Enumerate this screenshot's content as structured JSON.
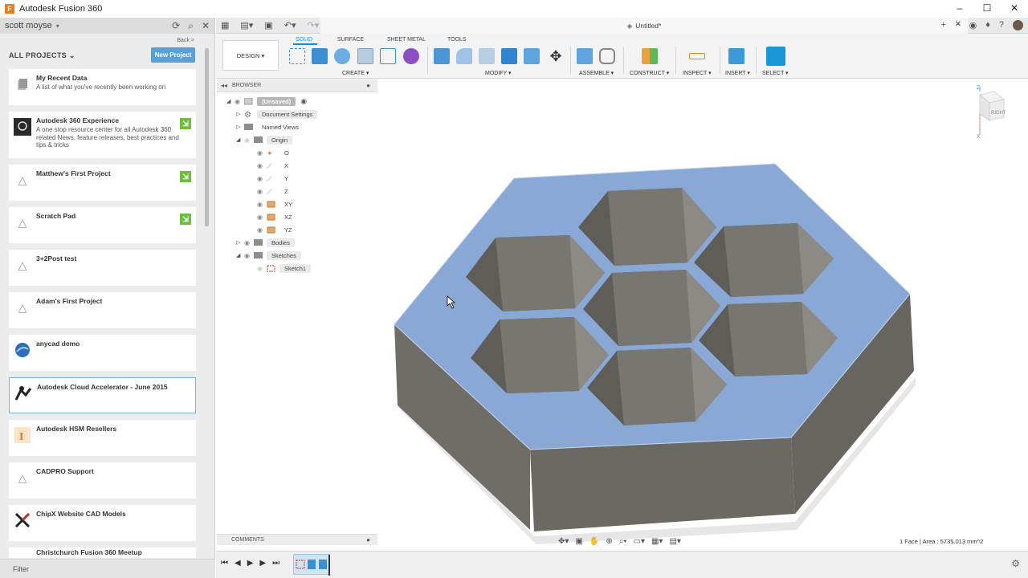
{
  "window": {
    "title": "Autodesk Fusion 360",
    "logo_letter": "F",
    "controls": [
      "–",
      "☐",
      "✕"
    ]
  },
  "data_panel": {
    "user": "scott moyse",
    "back_label": "Back >",
    "projects_heading": "ALL PROJECTS",
    "new_project_label": "New Project",
    "projects": [
      {
        "title": "My Recent Data",
        "description": "A list of what you've recently been working on",
        "icon": "file-icon",
        "badge": false,
        "selected": false
      },
      {
        "title": "Autodesk 360 Experience",
        "description": "A one stop resource center for all Autodesk 360 related News, feature releases, best practices and tips & tricks",
        "icon": "experience-logo-icon",
        "badge": true,
        "selected": false
      },
      {
        "title": "Matthew's First Project",
        "description": "",
        "icon": "project-icon",
        "badge": true,
        "selected": false
      },
      {
        "title": "Scratch Pad",
        "description": "",
        "icon": "project-icon",
        "badge": true,
        "selected": false
      },
      {
        "title": "3+2Post test",
        "description": "",
        "icon": "project-icon",
        "badge": false,
        "selected": false
      },
      {
        "title": "Adam's First Project",
        "description": "",
        "icon": "project-icon",
        "badge": false,
        "selected": false
      },
      {
        "title": "anycad demo",
        "description": "",
        "icon": "anycad-icon",
        "badge": false,
        "selected": false
      },
      {
        "title": "Autodesk Cloud Accelerator - June 2015",
        "description": "",
        "icon": "accelerator-icon",
        "badge": false,
        "selected": true
      },
      {
        "title": "Autodesk HSM Resellers",
        "description": "",
        "icon": "hsm-icon",
        "badge": false,
        "selected": false
      },
      {
        "title": "CADPRO Support",
        "description": "",
        "icon": "project-icon",
        "badge": false,
        "selected": false
      },
      {
        "title": "ChipX Website CAD Models",
        "description": "",
        "icon": "chipx-icon",
        "badge": false,
        "selected": false
      },
      {
        "title": "Christchurch Fusion 360 Meetup",
        "description": "",
        "icon": "project-icon",
        "badge": false,
        "selected": false
      }
    ],
    "filter_label": "Filter"
  },
  "document_tab": {
    "title": "Untitled*"
  },
  "toolbar": {
    "workspace": "DESIGN ▾",
    "tabs": [
      "SOLID",
      "SURFACE",
      "SHEET METAL",
      "TOOLS"
    ],
    "active_tab": "SOLID",
    "groups": [
      "CREATE ▾",
      "MODIFY ▾",
      "ASSEMBLE ▾",
      "CONSTRUCT ▾",
      "INSPECT ▾",
      "INSERT ▾",
      "SELECT ▾"
    ]
  },
  "browser": {
    "title": "BROWSER",
    "root": "(Unsaved)",
    "items": [
      {
        "label": "Document Settings",
        "icon": "gear-icon"
      },
      {
        "label": "Named Views",
        "icon": "folder-icon"
      },
      {
        "label": "Origin",
        "icon": "folder-icon"
      },
      {
        "label": "O",
        "icon": "origin-point-icon"
      },
      {
        "label": "X",
        "icon": "axis-icon"
      },
      {
        "label": "Y",
        "icon": "axis-icon"
      },
      {
        "label": "Z",
        "icon": "axis-icon"
      },
      {
        "label": "XY",
        "icon": "plane-icon"
      },
      {
        "label": "XZ",
        "icon": "plane-icon"
      },
      {
        "label": "YZ",
        "icon": "plane-icon"
      },
      {
        "label": "Bodies",
        "icon": "folder-icon"
      },
      {
        "label": "Sketches",
        "icon": "folder-icon"
      },
      {
        "label": "Sketch1",
        "icon": "sketch-icon"
      }
    ],
    "comments_label": "COMMENTS"
  },
  "viewcube": {
    "face_label": "RIGHT",
    "axis_z": "Z",
    "axis_x": "X"
  },
  "status": {
    "selection_info": "1 Face | Area : 5735.013 mm^2"
  },
  "colors": {
    "accent": "#0696d7",
    "top_face": "#8aa8d6",
    "side_face": "#6f6d67",
    "badge": "#6cbf3c"
  }
}
